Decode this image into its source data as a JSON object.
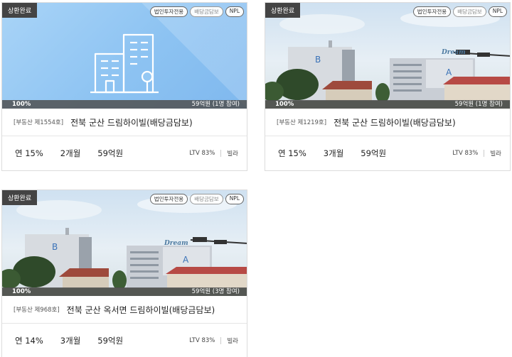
{
  "cards": [
    {
      "badge": "상환완료",
      "tags": [
        "법인투자전용",
        "배당금담보",
        "NPL"
      ],
      "progress_pct": "100%",
      "progress_fraction": 1.0,
      "amount_status": "59억원 (1명 참여)",
      "product_no": "[부동산 제1554호]",
      "title": "전북 군산 드림하이빌(배당금담보)",
      "rate": "연 15%",
      "period": "2개월",
      "amount": "59억원",
      "ltv": "LTV 83%",
      "type": "빌라",
      "image": "building-illustration"
    },
    {
      "badge": "상환완료",
      "tags": [
        "법인투자전용",
        "배당금담보",
        "NPL"
      ],
      "progress_pct": "100%",
      "progress_fraction": 1.0,
      "amount_status": "59억원 (1명 참여)",
      "product_no": "[부동산 제1219호]",
      "title": "전북 군산 드림하이빌(배당금담보)",
      "rate": "연 15%",
      "period": "3개월",
      "amount": "59억원",
      "ltv": "LTV 83%",
      "type": "빌라",
      "image": "apartment-photo",
      "photo_labels": {
        "b": "B",
        "a": "A",
        "sign": "Dream"
      }
    },
    {
      "badge": "상환완료",
      "tags": [
        "법인투자전용",
        "배당금담보",
        "NPL"
      ],
      "progress_pct": "100%",
      "progress_fraction": 1.0,
      "amount_status": "59억원 (3명 참여)",
      "product_no": "[부동산 제968호]",
      "title": "전북 군산 옥서면 드림하이빌(배당금담보)",
      "rate": "연 14%",
      "period": "3개월",
      "amount": "59억원",
      "ltv": "LTV 83%",
      "type": "빌라",
      "image": "apartment-photo",
      "photo_labels": {
        "b": "B",
        "a": "A",
        "sign": "Dream"
      }
    }
  ]
}
